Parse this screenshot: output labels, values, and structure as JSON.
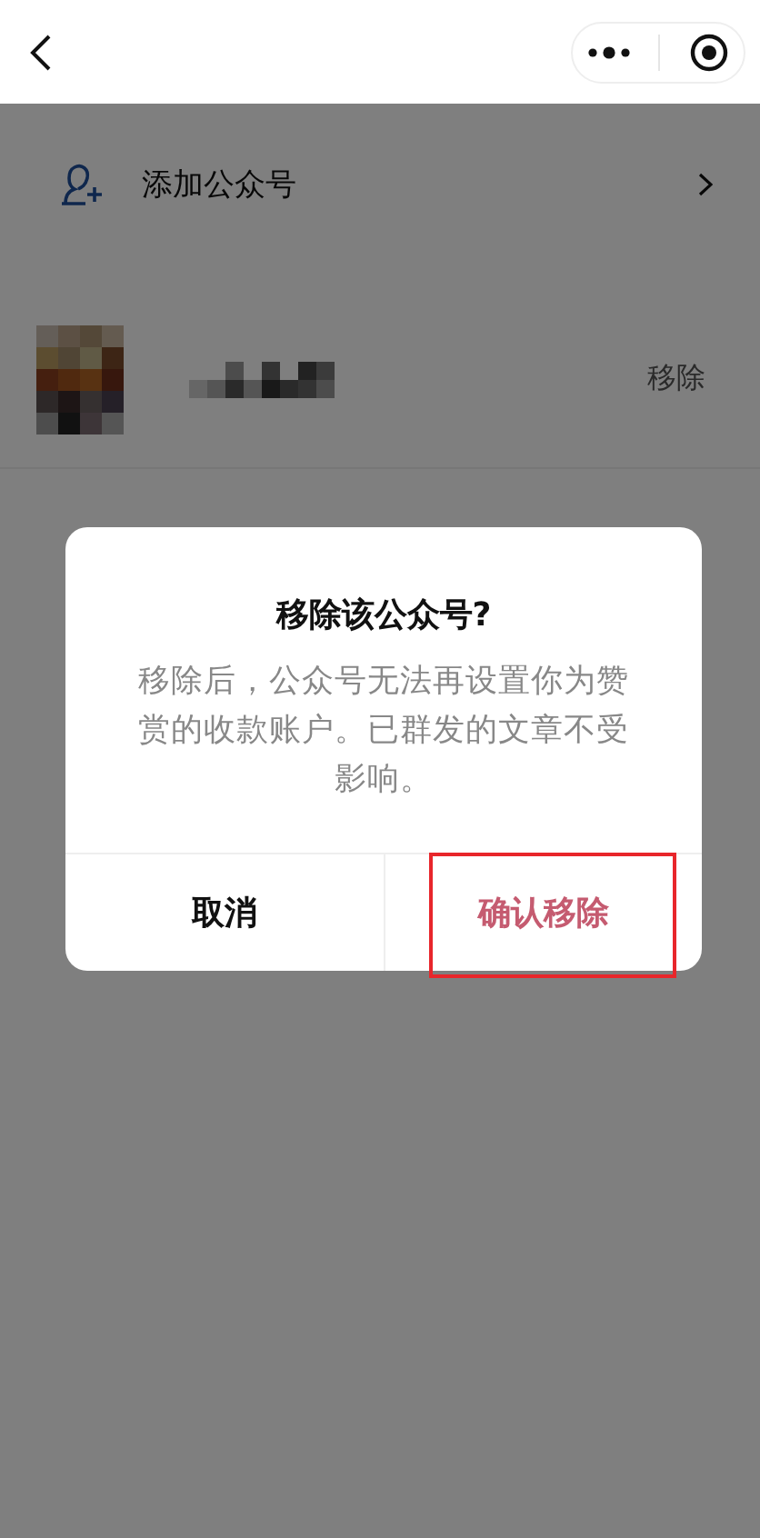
{
  "add_row": {
    "label": "添加公众号"
  },
  "accounts": [
    {
      "action": "移除"
    }
  ],
  "dialog": {
    "title": "移除该公众号?",
    "message": "移除后，公众号无法再设置你为赞赏的收款账户。已群发的文章不受影响。",
    "buttons": [
      {
        "kind": "cancel",
        "label": "取消",
        "highlighted": false
      },
      {
        "kind": "confirm",
        "label": "确认移除",
        "highlighted": true
      }
    ]
  }
}
